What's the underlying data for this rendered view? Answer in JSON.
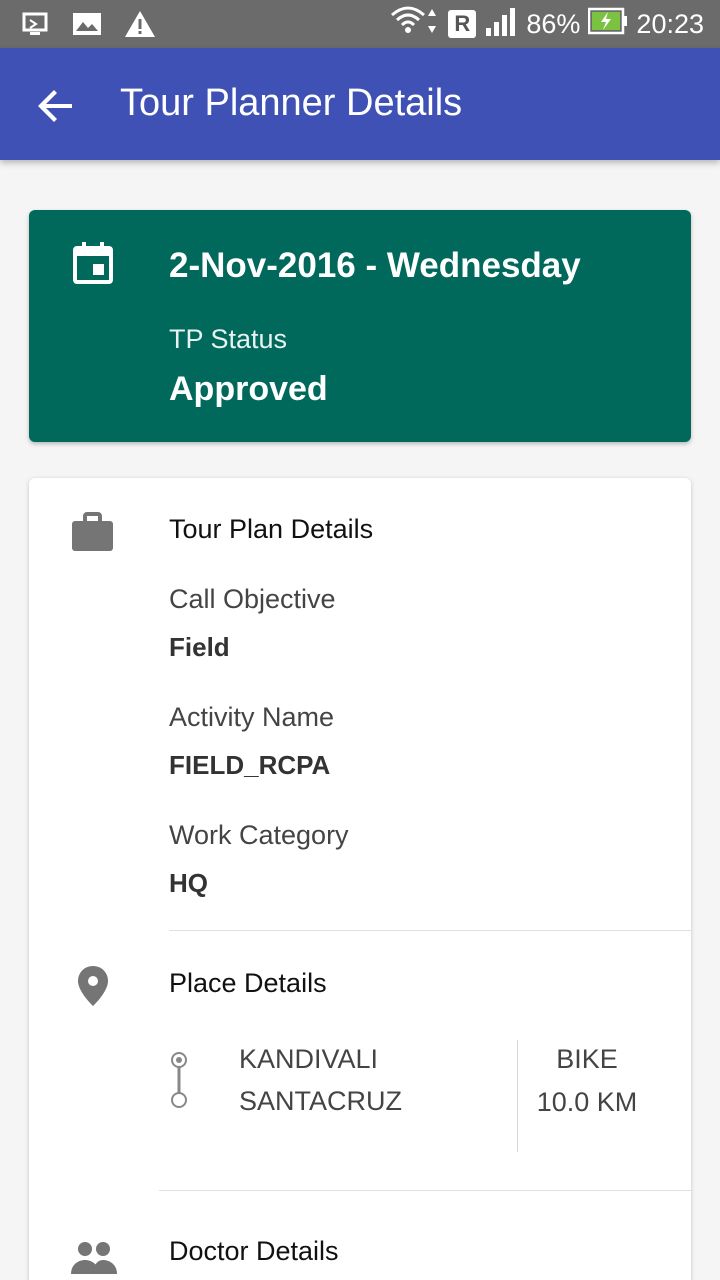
{
  "status_bar": {
    "battery": "86%",
    "time": "20:23",
    "roaming": "R"
  },
  "app_bar": {
    "title": "Tour Planner Details"
  },
  "status_card": {
    "date": "2-Nov-2016 - Wednesday",
    "status_label": "TP Status",
    "status_value": "Approved"
  },
  "tour_plan": {
    "title": "Tour Plan Details",
    "call_objective_label": "Call Objective",
    "call_objective_value": "Field",
    "activity_label": "Activity Name",
    "activity_value": "FIELD_RCPA",
    "work_category_label": "Work Category",
    "work_category_value": "HQ"
  },
  "place": {
    "title": "Place Details",
    "from": "KANDIVALI",
    "to": "SANTACRUZ",
    "mode": "BIKE",
    "distance": "10.0 KM"
  },
  "doctor": {
    "title": "Doctor Details"
  },
  "colors": {
    "app_bar": "#3f51b5",
    "status_card": "#00695c",
    "status_bar": "#6b6b6b"
  },
  "icons": [
    "usb-debug-icon",
    "image-icon",
    "warning-icon",
    "wifi-icon",
    "signal-icon",
    "battery-charging-icon",
    "back-arrow-icon",
    "calendar-icon",
    "briefcase-icon",
    "location-pin-icon",
    "route-icon",
    "people-icon"
  ]
}
